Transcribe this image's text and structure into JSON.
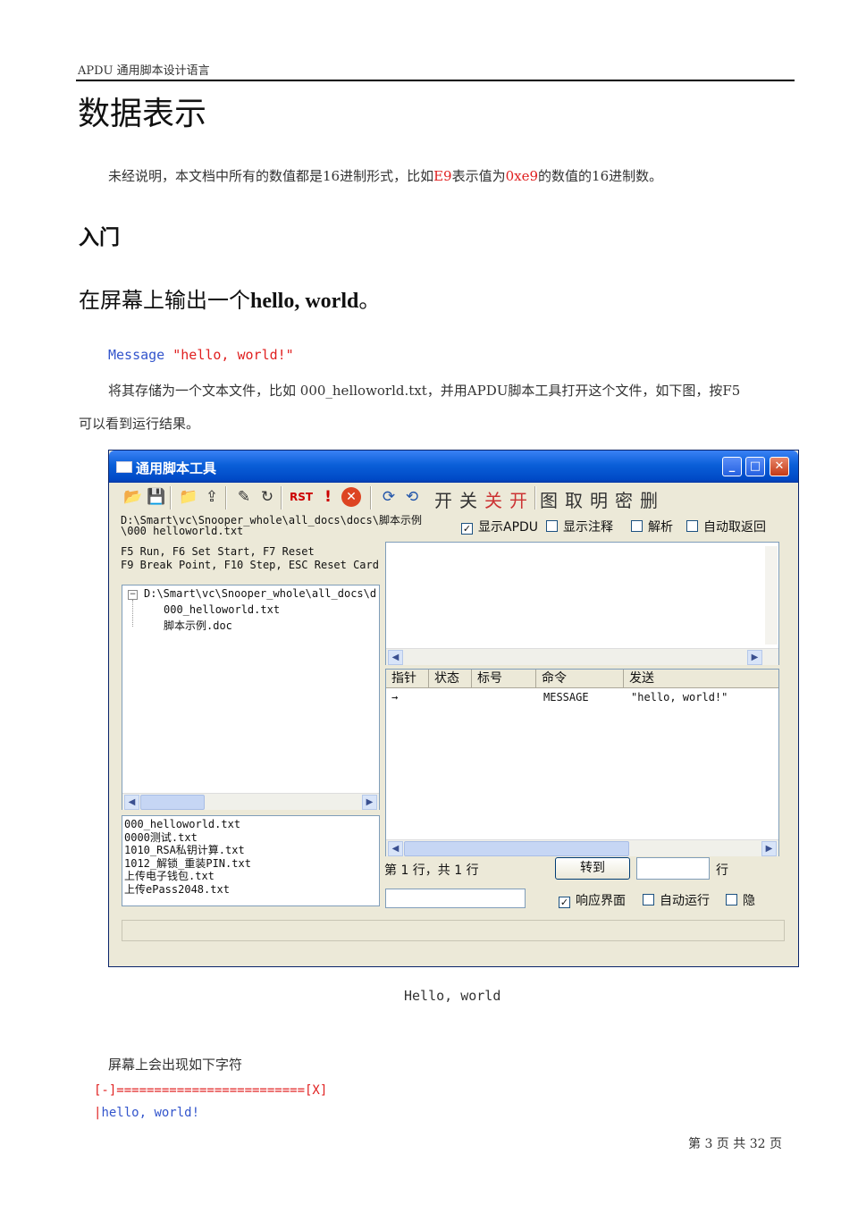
{
  "header": {
    "title": "APDU 通用脚本设计语言"
  },
  "heading1": "数据表示",
  "intro": {
    "before": "未经说明，本文档中所有的数值都是16进制形式，比如",
    "val1": "E9",
    "mid": "表示值为",
    "val2": "0xe9",
    "after": "的数值的16进制数。"
  },
  "heading2": "入门",
  "heading3": {
    "prefix": "在屏幕上输出一个",
    "bold": "hello, world",
    "suffix": "。"
  },
  "code_line": {
    "keyword": "Message",
    "string": "\"hello, world!\""
  },
  "para2": {
    "line1": "将其存储为一个文本文件，比如 000_helloworld.txt，并用APDU脚本工具打开这个文件，如下图，按F5",
    "line2": "可以看到运行结果。"
  },
  "window": {
    "title": "通用脚本工具",
    "toolbar_text": [
      "开",
      "关",
      "关",
      "开",
      "图",
      "取",
      "明",
      "密",
      "删"
    ],
    "path_line1": "D:\\Smart\\vc\\Snooper_whole\\all_docs\\docs\\脚本示例",
    "path_line2": "\\000_helloworld.txt",
    "checkboxes": [
      {
        "label": "显示APDU",
        "checked": true
      },
      {
        "label": "显示注释",
        "checked": false
      },
      {
        "label": "解析",
        "checked": false
      },
      {
        "label": "自动取返回",
        "checked": false
      }
    ],
    "keys_line1": "F5 Run, F6 Set Start, F7 Reset",
    "keys_line2": "F9 Break Point, F10 Step, ESC Reset Card",
    "tree": {
      "root": "D:\\Smart\\vc\\Snooper_whole\\all_docs\\d",
      "children": [
        "000_helloworld.txt",
        "脚本示例.doc"
      ]
    },
    "files": [
      "000_helloworld.txt",
      "0000测试.txt",
      "1010_RSA私钥计算.txt",
      "1012_解锁_重装PIN.txt",
      "上传电子钱包.txt",
      "上传ePass2048.txt"
    ],
    "grid": {
      "columns": [
        "指针",
        "状态",
        "标号",
        "命令",
        "发送"
      ],
      "row": {
        "pointer": "→",
        "command": "MESSAGE",
        "send": "\"hello, world!\""
      }
    },
    "line_status": "第 1 行，共 1 行",
    "goto_button": "转到",
    "line_label": "行",
    "bottom_checks": [
      {
        "label": "响应界面",
        "checked": true
      },
      {
        "label": "自动运行",
        "checked": false
      },
      {
        "label": "隐",
        "checked": false
      }
    ]
  },
  "caption": "Hello, world",
  "para3": "屏幕上会出现如下字符",
  "output": {
    "line1": "[-]=========================[X]",
    "bar": "|",
    "line2": "hello, world!"
  },
  "footer": "第 3 页 共 32 页"
}
